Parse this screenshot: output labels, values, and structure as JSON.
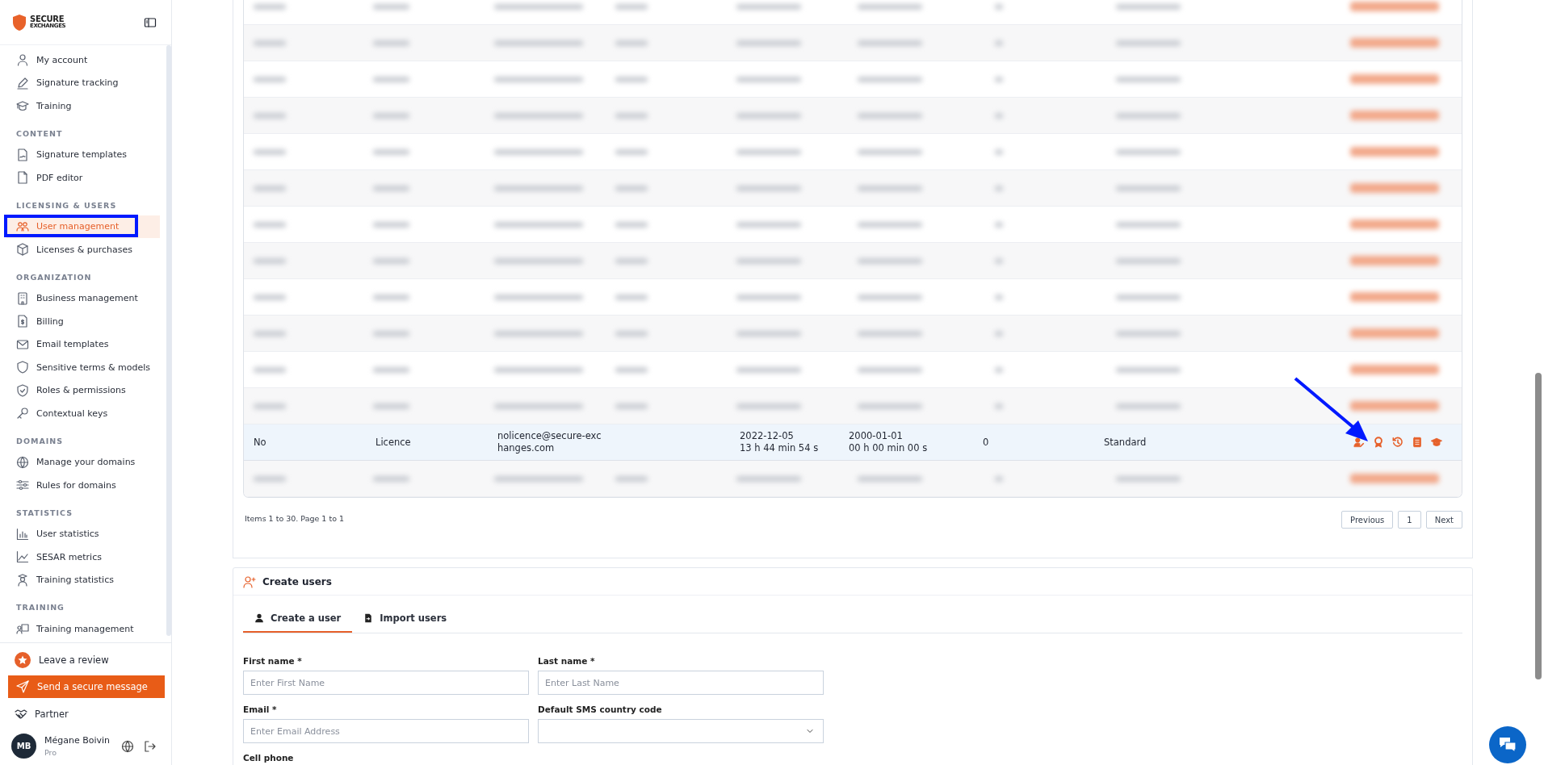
{
  "sidebar": {
    "logo": {
      "line_1": "SECURE",
      "line_2": "EXCHANGES"
    },
    "sections": [
      {
        "items": [
          {
            "label": "My account",
            "selected": false
          },
          {
            "label": "Signature tracking",
            "selected": false
          },
          {
            "label": "Training",
            "selected": false
          }
        ]
      },
      {
        "heading": "CONTENT",
        "items": [
          {
            "label": "Signature templates",
            "selected": false
          },
          {
            "label": "PDF editor",
            "selected": false
          }
        ]
      },
      {
        "heading": "LICENSING & USERS",
        "items": [
          {
            "label": "User management",
            "selected": true
          },
          {
            "label": "Licenses & purchases",
            "selected": false
          }
        ]
      },
      {
        "heading": "ORGANIZATION",
        "items": [
          {
            "label": "Business management",
            "selected": false
          },
          {
            "label": "Billing",
            "selected": false
          },
          {
            "label": "Email templates",
            "selected": false
          },
          {
            "label": "Sensitive terms & models",
            "selected": false
          },
          {
            "label": "Roles & permissions",
            "selected": false
          },
          {
            "label": "Contextual keys",
            "selected": false
          }
        ]
      },
      {
        "heading": "DOMAINS",
        "items": [
          {
            "label": "Manage your domains",
            "selected": false
          },
          {
            "label": "Rules for domains",
            "selected": false
          }
        ]
      },
      {
        "heading": "STATISTICS",
        "items": [
          {
            "label": "User statistics",
            "selected": false
          },
          {
            "label": "SESAR metrics",
            "selected": false
          },
          {
            "label": "Training statistics",
            "selected": false
          }
        ]
      },
      {
        "heading": "TRAINING",
        "items": [
          {
            "label": "Training management",
            "selected": false
          }
        ]
      }
    ],
    "review": "Leave a review",
    "send_button": "Send a secure message",
    "partner": "Partner",
    "user": {
      "initials": "MB",
      "name": "Mégane Boivin",
      "plan": "Pro"
    }
  },
  "table": {
    "rows": [
      {
        "selected": true,
        "cells": [
          "No",
          "Licence",
          "nolicence@secure-exc\nhanges.com",
          "",
          "2022-12-05\n13 h 44 min 54 s",
          "2000-01-01\n00 h 00 min 00 s",
          "0",
          "Standard"
        ]
      }
    ],
    "summary": "Items 1 to 30. Page 1 to 1",
    "pagination": [
      {
        "label": "Previous",
        "selected": false
      },
      {
        "label": "1",
        "selected": false
      },
      {
        "label": "Next",
        "selected": false
      }
    ]
  },
  "create_users": {
    "title": "Create users",
    "tabs": [
      {
        "label": "Create a user",
        "selected": true
      },
      {
        "label": "Import users",
        "selected": false
      }
    ],
    "fields": [
      {
        "kind": "text",
        "label": "First name *",
        "placeholder": "Enter First Name"
      },
      {
        "kind": "text",
        "label": "Last name *",
        "placeholder": "Enter Last Name"
      },
      {
        "kind": "text",
        "label": "Email *",
        "placeholder": "Enter Email Address"
      },
      {
        "kind": "select",
        "label": "Default SMS country code"
      },
      {
        "kind": "text",
        "label": "Cell phone"
      }
    ]
  }
}
